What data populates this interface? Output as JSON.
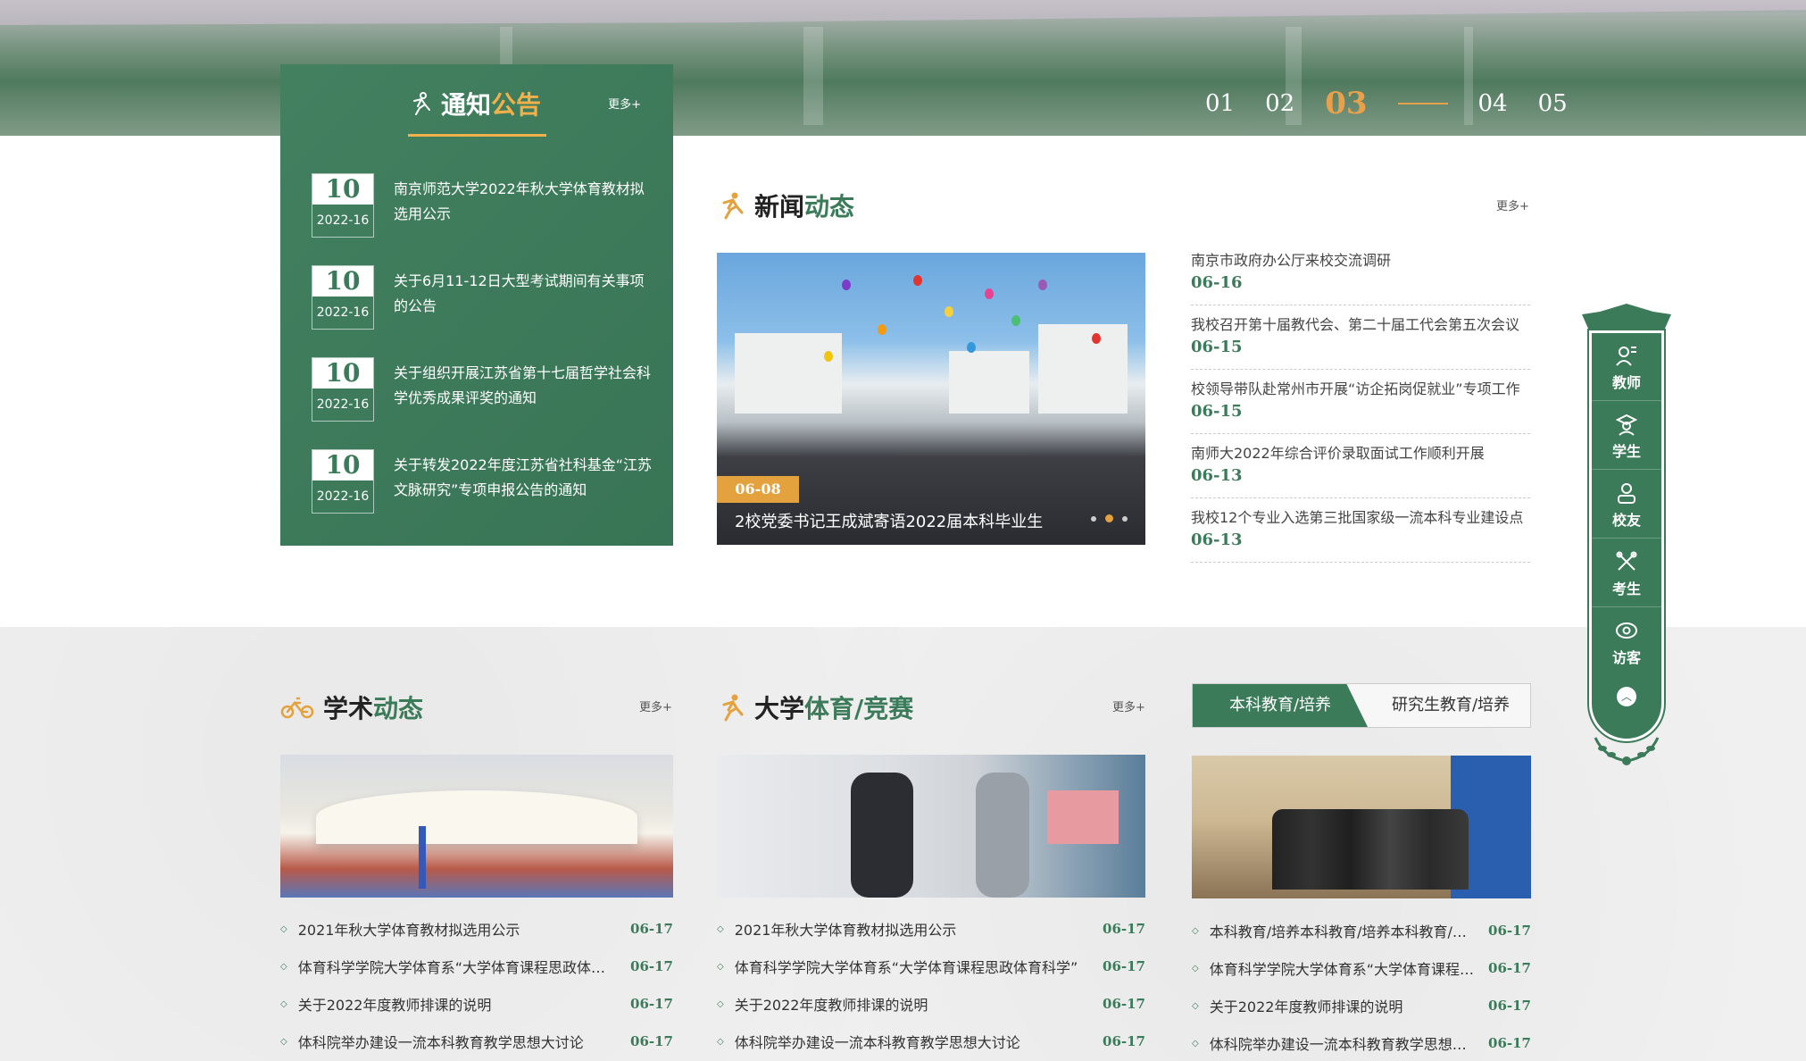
{
  "slider": {
    "numbers": [
      "01",
      "02",
      "03",
      "04",
      "05"
    ],
    "active_index": 2
  },
  "notice": {
    "title_main": "通知",
    "title_accent": "公告",
    "more": "更多+",
    "items": [
      {
        "day": "10",
        "ym": "2022-16",
        "title": "南京师范大学2022年秋大学体育教材拟选用公示"
      },
      {
        "day": "10",
        "ym": "2022-16",
        "title": "关于6月11-12日大型考试期间有关事项的公告"
      },
      {
        "day": "10",
        "ym": "2022-16",
        "title": "关于组织开展江苏省第十七届哲学社会科学优秀成果评奖的通知"
      },
      {
        "day": "10",
        "ym": "2022-16",
        "title": "关于转发2022年度江苏省社科基金“江苏文脉研究”专项申报公告的通知"
      }
    ]
  },
  "news": {
    "title_main": "新闻",
    "title_accent": "动态",
    "more": "更多+",
    "featured": {
      "date": "06-08",
      "caption": "2校党委书记王成斌寄语2022届本科毕业生"
    },
    "list": [
      {
        "title": "南京市政府办公厅来校交流调研",
        "date": "06-16"
      },
      {
        "title": "我校召开第十届教代会、第二十届工代会第五次会议",
        "date": "06-15"
      },
      {
        "title": "校领导带队赴常州市开展“访企拓岗促就业”专项工作",
        "date": "06-15"
      },
      {
        "title": "南师大2022年综合评价录取面试工作顺利开展",
        "date": "06-13"
      },
      {
        "title": "我校12个专业入选第三批国家级一流本科专业建设点",
        "date": "06-13"
      }
    ]
  },
  "academic": {
    "title_main": "学术",
    "title_accent": "动态",
    "more": "更多+",
    "items": [
      {
        "title": "2021年秋大学体育教材拟选用公示",
        "date": "06-17"
      },
      {
        "title": "体育科学学院大学体育系“大学体育课程思政体育科学”",
        "date": "06-17"
      },
      {
        "title": "关于2022年度教师排课的说明",
        "date": "06-17"
      },
      {
        "title": "体科院举办建设一流本科教育教学思想大讨论",
        "date": "06-17"
      }
    ]
  },
  "sports": {
    "title_main": "大学",
    "title_accent": "体育/竞赛",
    "more": "更多+",
    "items": [
      {
        "title": "2021年秋大学体育教材拟选用公示",
        "date": "06-17"
      },
      {
        "title": "体育科学学院大学体育系“大学体育课程思政体育科学”",
        "date": "06-17"
      },
      {
        "title": "关于2022年度教师排课的说明",
        "date": "06-17"
      },
      {
        "title": "体科院举办建设一流本科教育教学思想大讨论",
        "date": "06-17"
      }
    ]
  },
  "education": {
    "tab_active": "本科教育/培养",
    "tab_other": "研究生教育/培养",
    "items": [
      {
        "title": "本科教育/培养本科教育/培养本科教育/培养",
        "date": "06-17"
      },
      {
        "title": "体育科学学院大学体育系“大学体育课程思政”",
        "date": "06-17"
      },
      {
        "title": "关于2022年度教师排课的说明",
        "date": "06-17"
      },
      {
        "title": "体科院举办建设一流本科教育教学思想大讨论",
        "date": "06-17"
      }
    ]
  },
  "float_nav": {
    "items": [
      "教师",
      "学生",
      "校友",
      "考生",
      "访客"
    ]
  },
  "colors": {
    "primary_green": "#3b7b5a",
    "accent_orange": "#e3a23d"
  }
}
